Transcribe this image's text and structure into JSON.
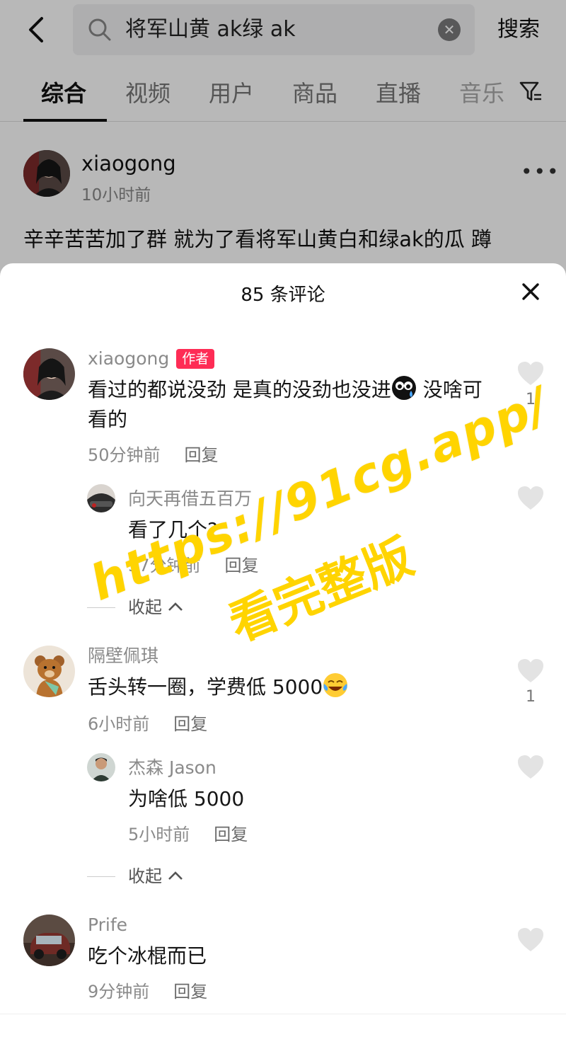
{
  "search": {
    "query": "将军山黄 ak绿 ak",
    "button_label": "搜索"
  },
  "tabs": [
    "综合",
    "视频",
    "用户",
    "商品",
    "直播",
    "音乐"
  ],
  "post": {
    "username": "xiaogong",
    "time": "10小时前",
    "body": "辛辛苦苦加了群 就为了看将军山黄白和绿ak的瓜 蹲"
  },
  "comments_sheet": {
    "title": "85 条评论",
    "comments": [
      {
        "user": "xiaogong",
        "badge": "作者",
        "text": "看过的都说没劲 是真的没劲也没进",
        "text_after_emoji": " 没啥可看的",
        "time": "50分钟前",
        "reply": "回复",
        "likes": "1"
      },
      {
        "user": "向天再借五百万",
        "text": "看了几个?",
        "time": "37分钟前",
        "reply": "回复",
        "collapse": "收起"
      },
      {
        "user": "隔壁佩琪",
        "text": "舌头转一圈，学费低 5000",
        "time": "6小时前",
        "reply": "回复",
        "likes": "1"
      },
      {
        "user": "杰森 Jason",
        "text": "为啥低 5000",
        "time": "5小时前",
        "reply": "回复",
        "collapse": "收起"
      },
      {
        "user": "Prife",
        "text": "吃个冰棍而已",
        "time": "9分钟前",
        "reply": "回复"
      }
    ]
  },
  "watermark": {
    "line1": "https://91cg.app/",
    "line2": "看完整版"
  },
  "colors": {
    "accent": "#fe2c55",
    "watermark": "#ffd400"
  }
}
